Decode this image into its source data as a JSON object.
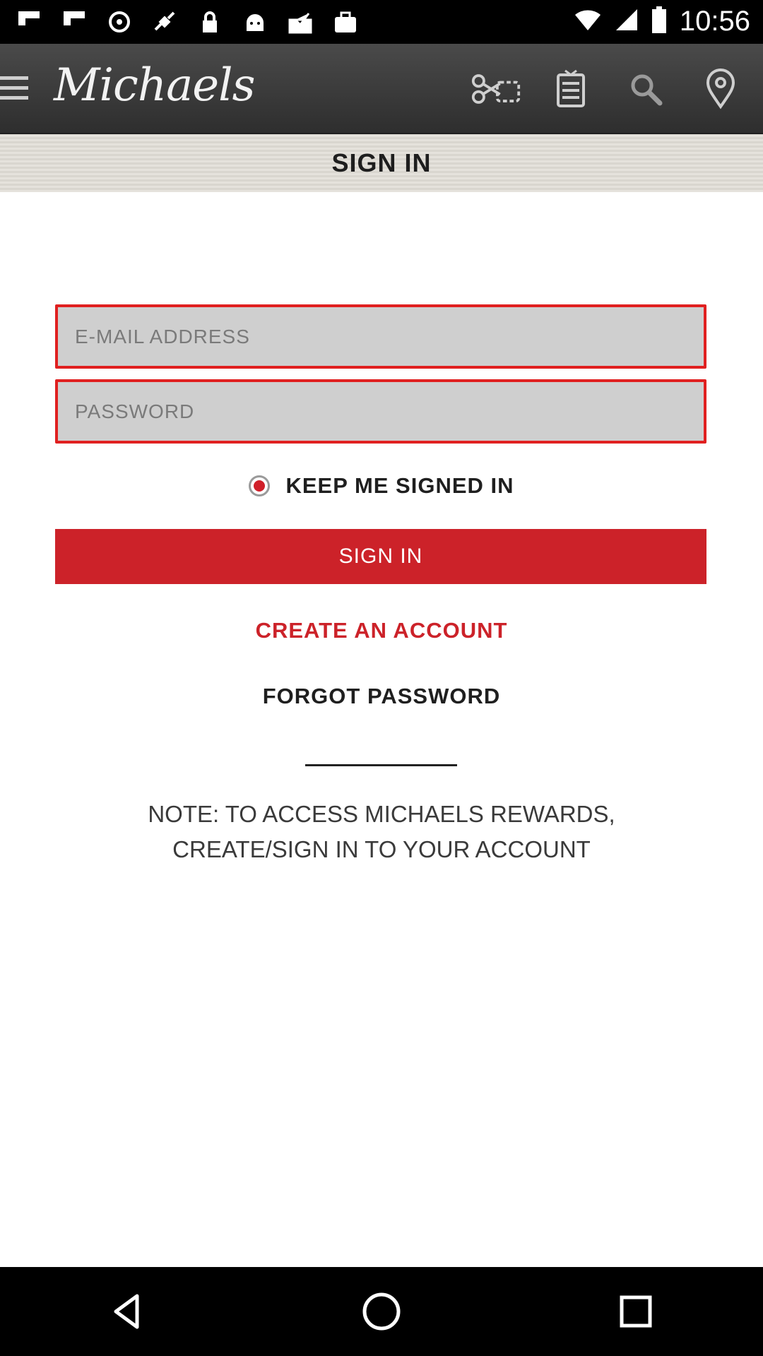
{
  "status_bar": {
    "time": "10:56",
    "icons": [
      "flipboard-icon",
      "flipboard-icon",
      "sync-icon",
      "satellite-icon",
      "lock-icon",
      "android-icon",
      "inbox-icon",
      "briefcase-icon"
    ],
    "right_icons": [
      "wifi-icon",
      "signal-icon",
      "battery-icon"
    ]
  },
  "app_bar": {
    "brand": "Michaels",
    "actions": [
      "coupon-scissors-icon",
      "gift-card-icon",
      "search-icon",
      "location-pin-icon"
    ]
  },
  "header": {
    "title": "SIGN IN"
  },
  "form": {
    "email_placeholder": "E-MAIL ADDRESS",
    "email_value": "",
    "password_placeholder": "PASSWORD",
    "password_value": "",
    "keep_signed_in_label": "KEEP ME SIGNED IN",
    "keep_signed_in_checked": true,
    "sign_in_button": "SIGN IN",
    "create_account_link": "CREATE AN ACCOUNT",
    "forgot_password_link": "FORGOT PASSWORD"
  },
  "note": {
    "line1": "NOTE: TO ACCESS MICHAELS REWARDS,",
    "line2": "CREATE/SIGN IN TO YOUR ACCOUNT"
  },
  "colors": {
    "accent_red": "#cc2229",
    "field_border": "#e02020",
    "field_fill": "#cfcfcf"
  },
  "nav_bar": {
    "buttons": [
      "back-icon",
      "home-icon",
      "recents-icon"
    ]
  }
}
